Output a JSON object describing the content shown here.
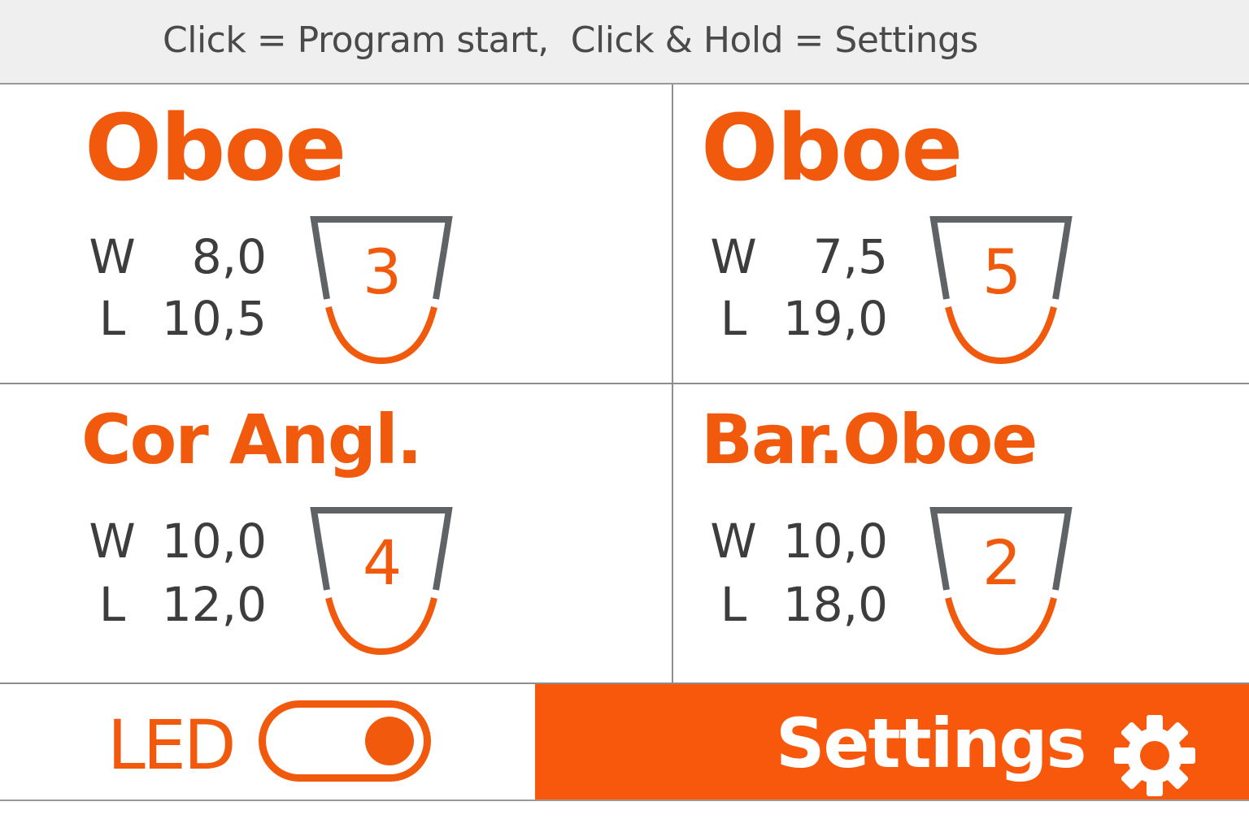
{
  "header": {
    "hint": "Click = Program start,  Click & Hold = Settings"
  },
  "programs": [
    {
      "name": "Oboe",
      "width_key": "W",
      "width_value": "8,0",
      "length_key": "L",
      "length_value": "10,5",
      "reed_number": "3"
    },
    {
      "name": "Oboe",
      "width_key": "W",
      "width_value": "7,5",
      "length_key": "L",
      "length_value": "19,0",
      "reed_number": "5"
    },
    {
      "name": "Cor Angl.",
      "width_key": "W",
      "width_value": "10,0",
      "length_key": "L",
      "length_value": "12,0",
      "reed_number": "4"
    },
    {
      "name": "Bar.Oboe",
      "width_key": "W",
      "width_value": "10,0",
      "length_key": "L",
      "length_value": "18,0",
      "reed_number": "2"
    }
  ],
  "footer": {
    "led_label": "LED",
    "led_toggle": {
      "state": "on"
    },
    "settings_label": "Settings",
    "settings_icon": "gear-icon"
  },
  "colors": {
    "accent": "#f15a0d",
    "button_background": "#f7580b",
    "text_dark": "#3d3d3d",
    "reed_outline": "#5f6366",
    "header_background": "#efefef"
  }
}
